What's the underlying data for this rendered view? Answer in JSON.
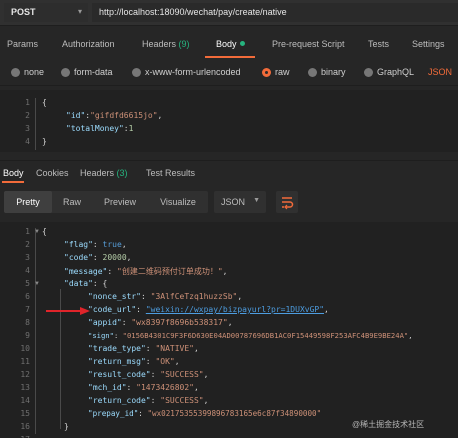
{
  "request": {
    "method": "POST",
    "url": "http://localhost:18090/wechat/pay/create/native"
  },
  "request_tabs": [
    {
      "label": "Params"
    },
    {
      "label": "Authorization"
    },
    {
      "label": "Headers",
      "count": "(9)"
    },
    {
      "label": "Body",
      "active": true
    },
    {
      "label": "Pre-request Script"
    },
    {
      "label": "Tests"
    },
    {
      "label": "Settings"
    }
  ],
  "body_types": [
    {
      "label": "none"
    },
    {
      "label": "form-data"
    },
    {
      "label": "x-www-form-urlencoded"
    },
    {
      "label": "raw",
      "selected": true
    },
    {
      "label": "binary"
    },
    {
      "label": "GraphQL"
    }
  ],
  "body_format": "JSON",
  "request_body": {
    "line_numbers": [
      "1",
      "2",
      "3",
      "4"
    ],
    "open": "{",
    "id_key": "\"id\"",
    "id_value": "\"gifdfd6615jo\"",
    "total_key": "\"totalMoney\"",
    "total_value": "1",
    "close": "}"
  },
  "response_tabs": [
    {
      "label": "Body",
      "active": true
    },
    {
      "label": "Cookies"
    },
    {
      "label": "Headers",
      "count": "(3)"
    },
    {
      "label": "Test Results"
    }
  ],
  "view_modes": [
    "Pretty",
    "Raw",
    "Preview",
    "Visualize"
  ],
  "response_format": "JSON",
  "response_body": {
    "line_numbers": [
      "1",
      "2",
      "3",
      "4",
      "5",
      "6",
      "7",
      "8",
      "9",
      "10",
      "11",
      "12",
      "13",
      "14",
      "15",
      "16",
      "17"
    ],
    "lines": {
      "l1": "{",
      "flag_key": "\"flag\"",
      "flag_val": "true",
      "code_key": "\"code\"",
      "code_val": "20000",
      "message_key": "\"message\"",
      "message_val": "\"创建二维码预付订单成功！\"",
      "data_key": "\"data\"",
      "data_open": "{",
      "nonce_key": "\"nonce_str\"",
      "nonce_val": "\"3AlfCeTzq1huzzSb\"",
      "codeurl_key": "\"code_url\"",
      "codeurl_val": "\"weixin://wxpay/bizpayurl?pr=1DUXvGP\"",
      "appid_key": "\"appid\"",
      "appid_val": "\"wx8397f8696b538317\"",
      "sign_key": "\"sign\"",
      "sign_val": "\"0156B4301C9F3F6D630E04AD00787696DB1AC0F15449598F253AFC4B9E9BE24A\"",
      "trade_key": "\"trade_type\"",
      "trade_val": "\"NATIVE\"",
      "retmsg_key": "\"return_msg\"",
      "retmsg_val": "\"OK\"",
      "result_key": "\"result_code\"",
      "result_val": "\"SUCCESS\"",
      "mch_key": "\"mch_id\"",
      "mch_val": "\"1473426802\"",
      "retcode_key": "\"return_code\"",
      "retcode_val": "\"SUCCESS\"",
      "prepay_key": "\"prepay_id\"",
      "prepay_val": "\"wx02175355399896783165e6c87f34890000\"",
      "l17": "}"
    }
  },
  "watermark": "@稀土掘金技术社区",
  "colors": {
    "accent": "#f26b3a",
    "success": "#26b47f",
    "annotation_arrow": "#e0242a"
  }
}
